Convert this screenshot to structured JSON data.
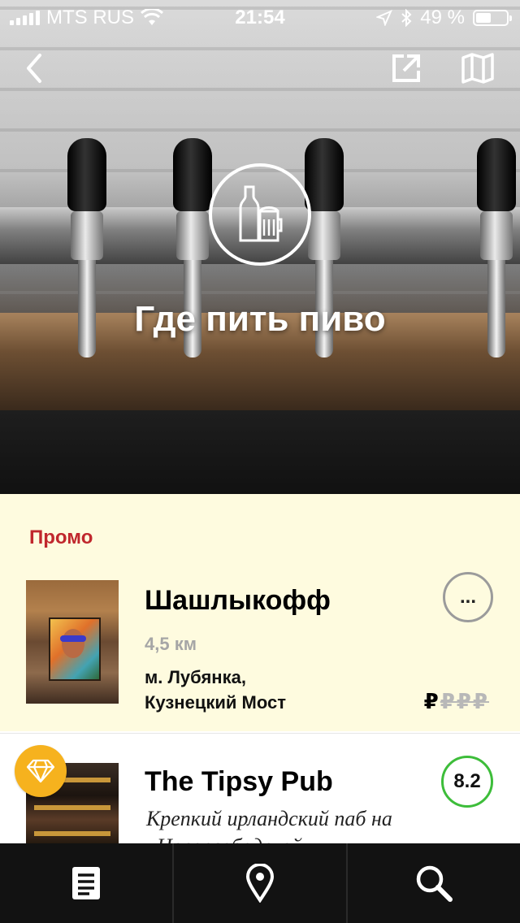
{
  "status_bar": {
    "carrier": "MTS RUS",
    "time": "21:54",
    "battery_percent": "49 %",
    "battery_level": 0.49
  },
  "hero": {
    "title": "Где пить пиво"
  },
  "promo": {
    "label": "Промо",
    "place": {
      "name": "Шашлыкофф",
      "distance": "4,5 км",
      "address_line1": "м. Лубянка,",
      "address_line2": "Кузнецкий Мост",
      "price_active": "₽",
      "price_inactive": "₽₽₽",
      "more_label": "..."
    }
  },
  "list": {
    "items": [
      {
        "name": "The Tipsy Pub",
        "rating": "8.2",
        "description_line1": "Крепкий ирландский паб на",
        "description_line2": "«Новослободской»"
      }
    ]
  },
  "colors": {
    "promo_bg": "#fefbdf",
    "promo_label": "#c0272d",
    "rating_ring": "#3dbd3a",
    "premium_badge": "#f6b21e",
    "tabbar_bg": "#121212"
  },
  "icons": {
    "back": "chevron-left-icon",
    "share": "share-external-icon",
    "map": "map-icon",
    "category": "beer-bottle-icon",
    "premium": "diamond-icon",
    "tab_list": "list-document-icon",
    "tab_map": "location-pin-icon",
    "tab_search": "search-icon"
  }
}
